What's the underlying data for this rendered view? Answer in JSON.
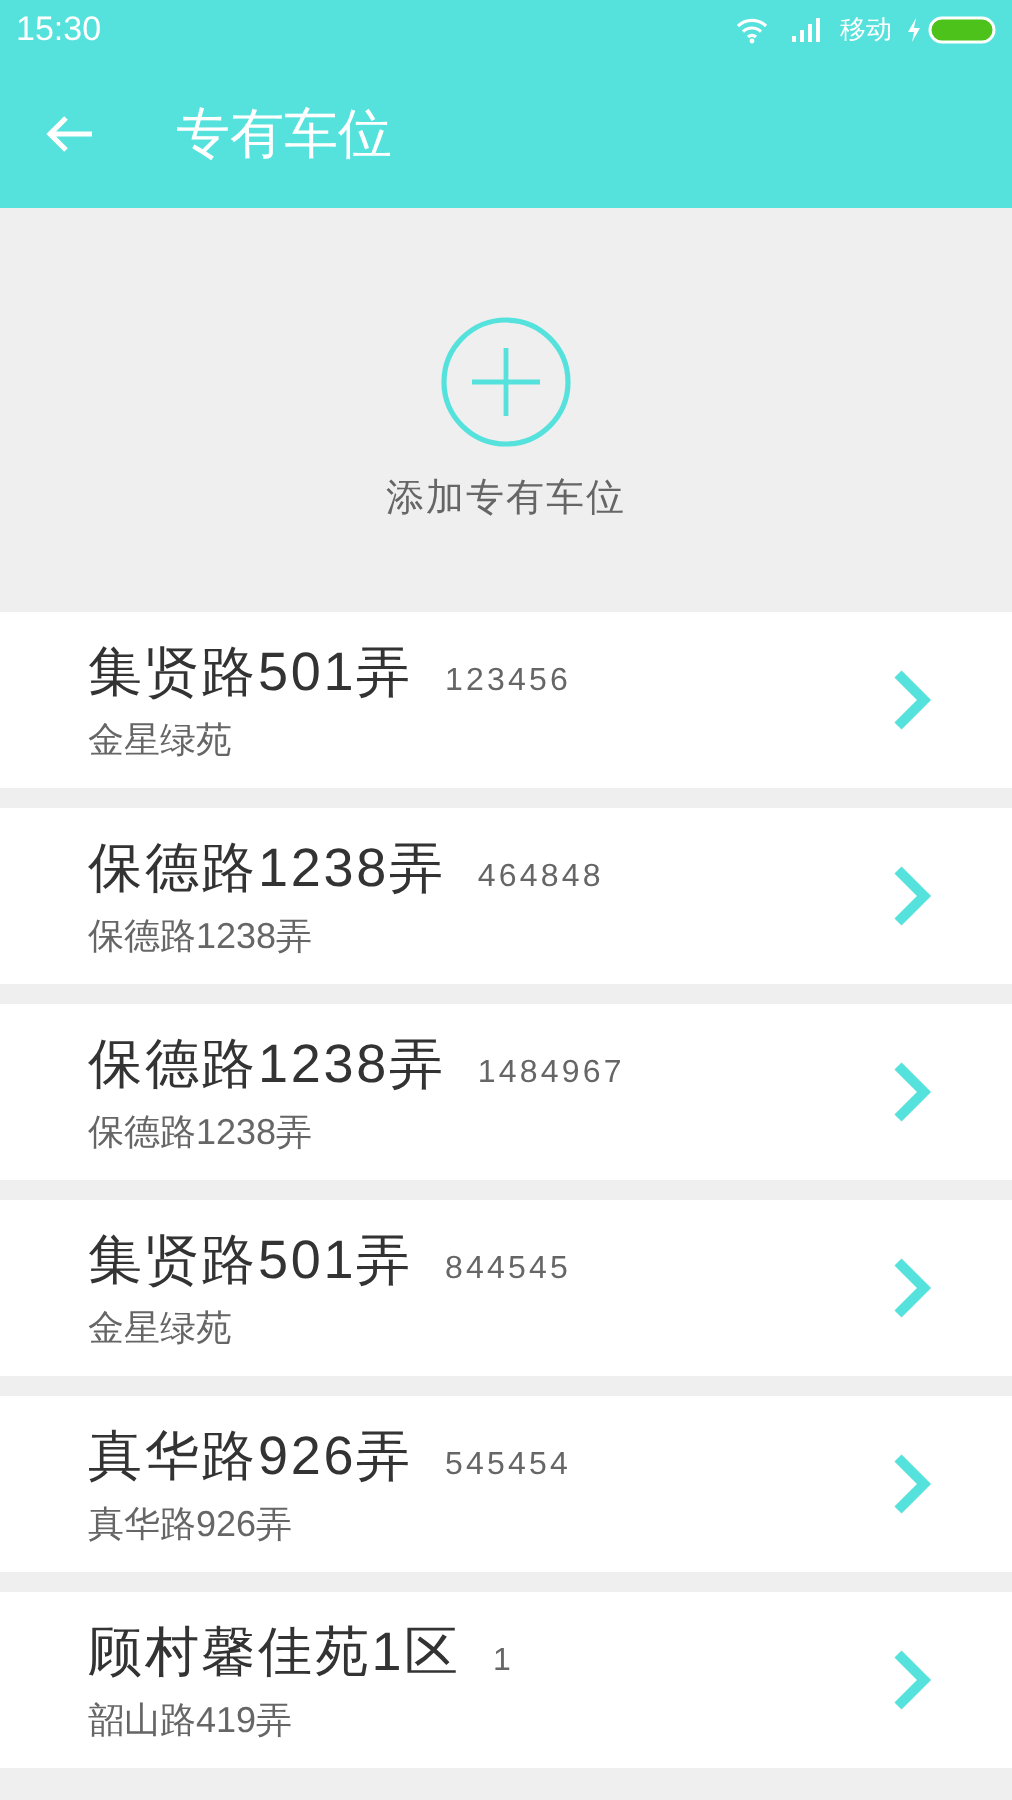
{
  "status_bar": {
    "time": "15:30",
    "carrier": "移动"
  },
  "header": {
    "title": "专有车位"
  },
  "add_button": {
    "label": "添加专有车位"
  },
  "spots": [
    {
      "name": "集贤路501弄",
      "code": "123456",
      "address": "金星绿苑"
    },
    {
      "name": "保德路1238弄",
      "code": "464848",
      "address": "保德路1238弄"
    },
    {
      "name": "保德路1238弄",
      "code": "1484967",
      "address": "保德路1238弄"
    },
    {
      "name": "集贤路501弄",
      "code": "844545",
      "address": "金星绿苑"
    },
    {
      "name": "真华路926弄",
      "code": "545454",
      "address": "真华路926弄"
    },
    {
      "name": "顾村馨佳苑1区",
      "code": "1",
      "address": "韶山路419弄"
    }
  ]
}
